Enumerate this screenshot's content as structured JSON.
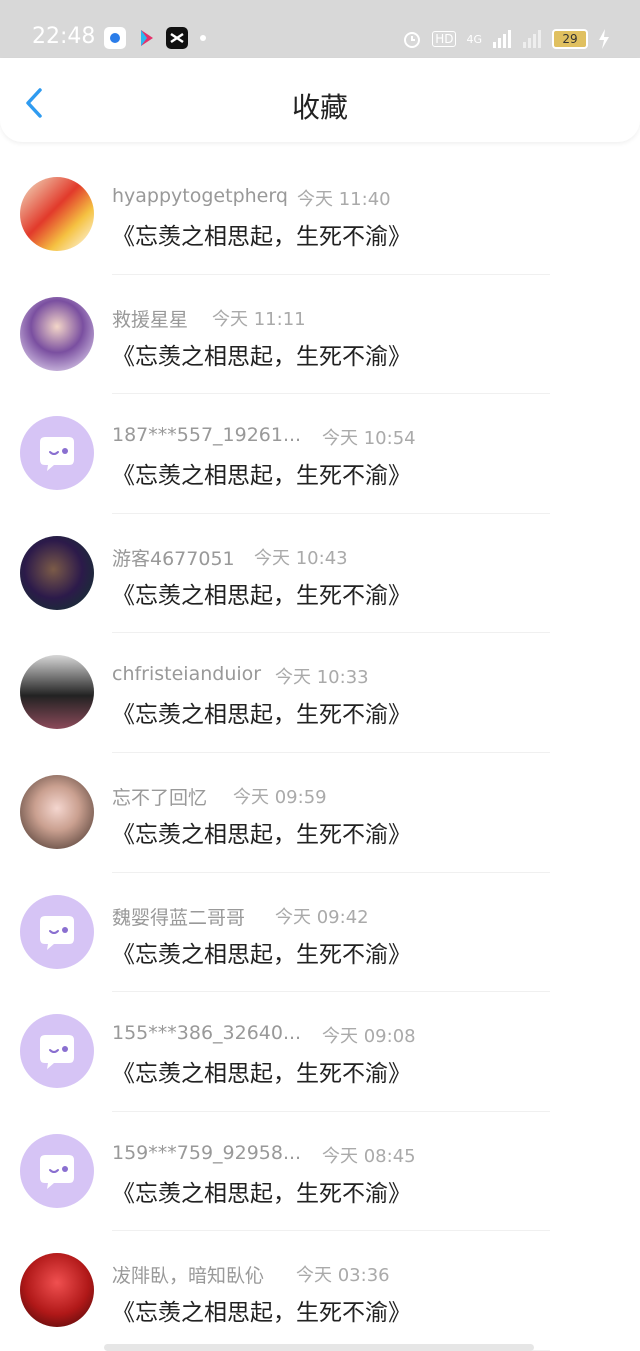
{
  "status": {
    "time": "22:48",
    "network": "4G",
    "hd": "HD",
    "battery": "29"
  },
  "header": {
    "title": "收藏"
  },
  "items": [
    {
      "user": "hyappytogetpherq",
      "time": "今天 11:40",
      "title": "《忘羡之相思起，生死不渝》",
      "avatar": "photo"
    },
    {
      "user": "救援星星",
      "time": "今天 11:11",
      "title": "《忘羡之相思起，生死不渝》",
      "avatar": "photo"
    },
    {
      "user": "187***557_19261...",
      "time": "今天 10:54",
      "title": "《忘羡之相思起，生死不渝》",
      "avatar": "default"
    },
    {
      "user": "游客4677051",
      "time": "今天 10:43",
      "title": "《忘羡之相思起，生死不渝》",
      "avatar": "photo"
    },
    {
      "user": "chfristeianduior",
      "time": "今天 10:33",
      "title": "《忘羡之相思起，生死不渝》",
      "avatar": "photo"
    },
    {
      "user": "忘不了回忆",
      "time": "今天 09:59",
      "title": "《忘羡之相思起，生死不渝》",
      "avatar": "photo"
    },
    {
      "user": "魏婴得蓝二哥哥",
      "time": "今天 09:42",
      "title": "《忘羡之相思起，生死不渝》",
      "avatar": "default"
    },
    {
      "user": "155***386_32640...",
      "time": "今天 09:08",
      "title": "《忘羡之相思起，生死不渝》",
      "avatar": "default"
    },
    {
      "user": "159***759_92958...",
      "time": "今天 08:45",
      "title": "《忘羡之相思起，生死不渝》",
      "avatar": "default"
    },
    {
      "user": "冹陫臥，暗知臥伈",
      "time": "今天 03:36",
      "title": "《忘羡之相思起，生死不渝》",
      "avatar": "photo"
    }
  ],
  "colors": {
    "accent": "#2f9bf0",
    "default_avatar_bg": "#d6c4f5",
    "statusbar_bg": "#d8d8d8"
  }
}
